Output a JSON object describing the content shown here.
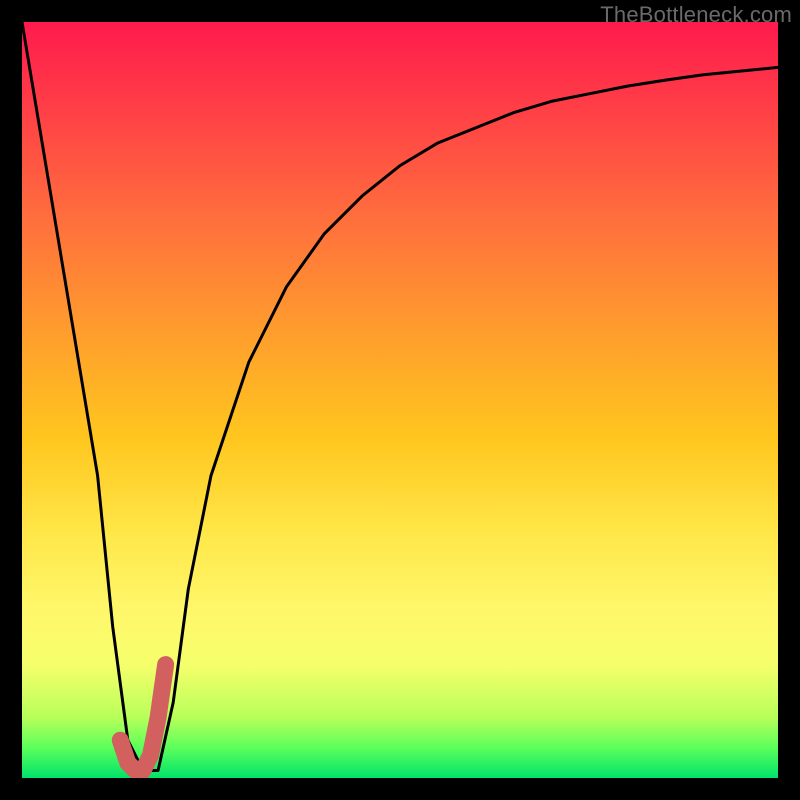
{
  "watermark": "TheBottleneck.com",
  "chart_data": {
    "type": "line",
    "title": "",
    "xlabel": "",
    "ylabel": "",
    "xlim": [
      0,
      100
    ],
    "ylim": [
      0,
      100
    ],
    "grid": false,
    "legend": false,
    "series": [
      {
        "name": "bottleneck-curve",
        "x": [
          0,
          5,
          10,
          12,
          14,
          16,
          18,
          20,
          22,
          25,
          30,
          35,
          40,
          45,
          50,
          55,
          60,
          65,
          70,
          75,
          80,
          85,
          90,
          95,
          100
        ],
        "values": [
          100,
          70,
          40,
          20,
          5,
          1,
          1,
          10,
          25,
          40,
          55,
          65,
          72,
          77,
          81,
          84,
          86,
          88,
          89.5,
          90.5,
          91.5,
          92.3,
          93,
          93.5,
          94
        ]
      },
      {
        "name": "highlight-J",
        "x": [
          13,
          14,
          15,
          16,
          17,
          18,
          19
        ],
        "values": [
          5,
          2,
          1,
          1,
          3,
          8,
          15
        ]
      }
    ],
    "colors": {
      "curve": "#000000",
      "highlight": "#d1605e",
      "gradient_top": "#ff1a4d",
      "gradient_bottom": "#00e36a"
    }
  }
}
